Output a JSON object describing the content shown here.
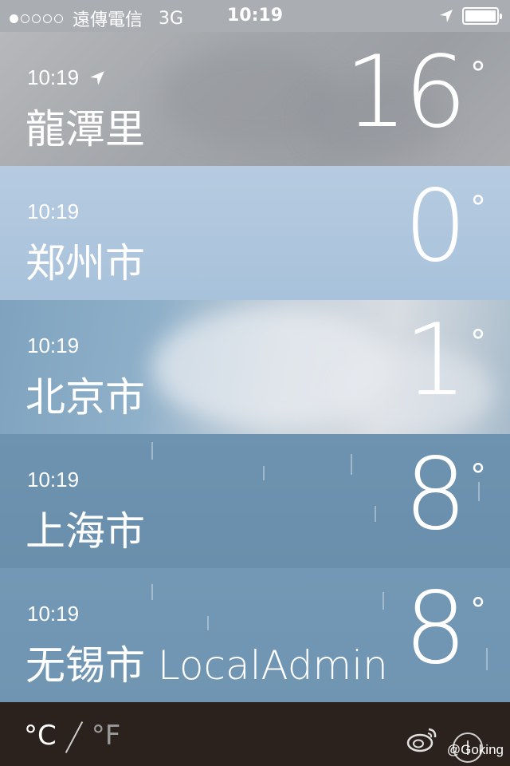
{
  "status_bar": {
    "carrier": "遠傳電信",
    "network": "3G",
    "time": "10:19",
    "signal_bars_filled": 1,
    "signal_bars_total": 5,
    "battery_level": 1.0
  },
  "cities": [
    {
      "time": "10:19",
      "current_location": true,
      "name": "龍潭里",
      "temperature": "16",
      "degree_symbol": "°"
    },
    {
      "time": "10:19",
      "current_location": false,
      "name": "郑州市",
      "temperature": "0",
      "degree_symbol": "°"
    },
    {
      "time": "10:19",
      "current_location": false,
      "name": "北京市",
      "temperature": "1",
      "degree_symbol": "°"
    },
    {
      "time": "10:19",
      "current_location": false,
      "name": "上海市",
      "temperature": "8",
      "degree_symbol": "°"
    },
    {
      "time": "10:19",
      "current_location": false,
      "name": "无锡市 LocalAdmin",
      "temperature": "8",
      "degree_symbol": "°"
    }
  ],
  "bottom_bar": {
    "celsius_label": "°C",
    "fahrenheit_label": "°F",
    "watermark": "@Goking"
  },
  "icons": {
    "location": "location-arrow-icon",
    "weibo": "weibo-icon",
    "list": "list-icon"
  }
}
